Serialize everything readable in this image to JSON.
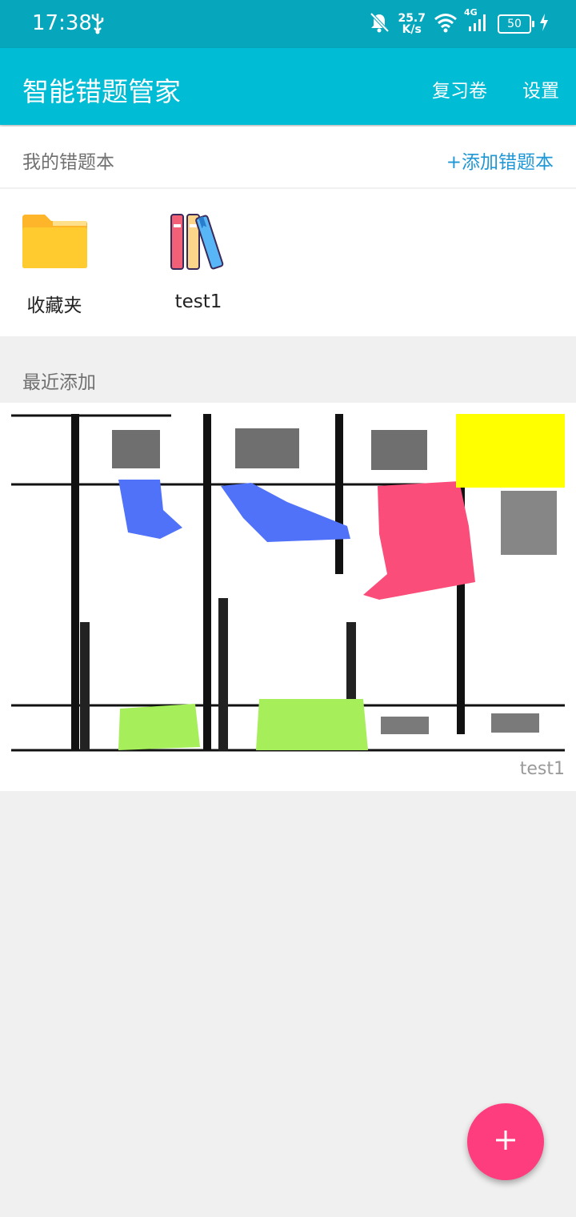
{
  "status": {
    "time": "17:38",
    "speed_value": "25.7",
    "speed_unit": "K/s",
    "network": "4G",
    "battery": "50"
  },
  "appbar": {
    "title": "智能错题管家",
    "review": "复习卷",
    "settings": "设置"
  },
  "notebooks_section": {
    "title": "我的错题本",
    "add_label": "+添加错题本",
    "items": [
      {
        "label": "收藏夹",
        "icon": "folder-icon"
      },
      {
        "label": "test1",
        "icon": "books-icon"
      }
    ]
  },
  "recent": {
    "title": "最近添加",
    "items": [
      {
        "notebook": "test1"
      }
    ]
  },
  "fab": {
    "label": "+"
  },
  "colors": {
    "statusbar": "#06a7bc",
    "appbar": "#00bcd4",
    "accent_link": "#1e97d4",
    "fab": "#fe3d7e",
    "folder": "#ffc92e"
  }
}
